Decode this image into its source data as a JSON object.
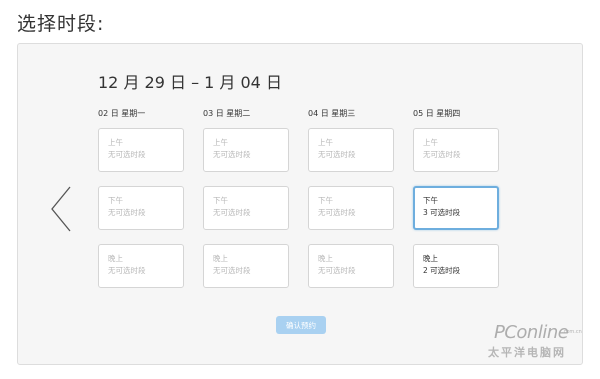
{
  "page_title": "选择时段:",
  "date_range": "12 月 29 日 – 1 月 04 日",
  "confirm_label": "确认预约",
  "days": [
    {
      "label": "02 日 星期一"
    },
    {
      "label": "03 日 星期二"
    },
    {
      "label": "04 日 星期三"
    },
    {
      "label": "05 日 星期四"
    }
  ],
  "slots": [
    [
      {
        "period": "上午",
        "status": "无可选时段"
      },
      {
        "period": "上午",
        "status": "无可选时段"
      },
      {
        "period": "上午",
        "status": "无可选时段"
      },
      {
        "period": "上午",
        "status": "无可选时段"
      }
    ],
    [
      {
        "period": "下午",
        "status": "无可选时段"
      },
      {
        "period": "下午",
        "status": "无可选时段"
      },
      {
        "period": "下午",
        "status": "无可选时段"
      },
      {
        "period": "下午",
        "status": "3 可选时段"
      }
    ],
    [
      {
        "period": "晚上",
        "status": "无可选时段"
      },
      {
        "period": "晚上",
        "status": "无可选时段"
      },
      {
        "period": "晚上",
        "status": "无可选时段"
      },
      {
        "period": "晚上",
        "status": "2 可选时段"
      }
    ]
  ],
  "watermark": {
    "brand": "PConline",
    "domain": ".com.cn",
    "cn_text": "太平洋电脑网"
  },
  "colors": {
    "selected_border": "#6eaede",
    "confirm_button": "#a9d1f1",
    "disabled_text": "#b8b8b8"
  },
  "icons": {
    "prev": "chevron-left-icon"
  }
}
